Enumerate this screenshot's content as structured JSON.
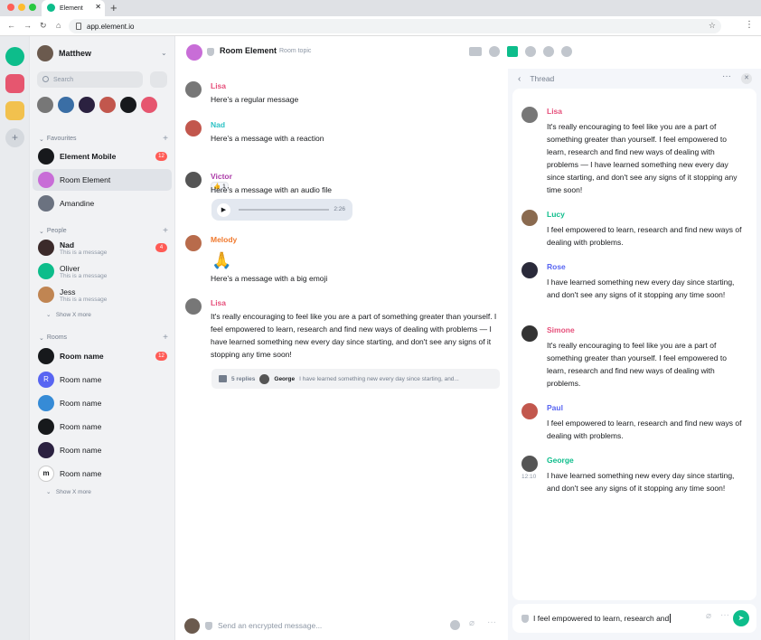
{
  "browser": {
    "tab_title": "Element",
    "url": "app.element.io",
    "dot_colors": [
      "#ff5f57",
      "#febc2e",
      "#28c840"
    ]
  },
  "user": {
    "name": "Matthew"
  },
  "search": {
    "placeholder": "Search"
  },
  "sections": {
    "favourites": "Favourites",
    "people": "People",
    "rooms": "Rooms",
    "show_more": "Show X more"
  },
  "favourites": [
    {
      "name": "Element Mobile",
      "badge": "12",
      "color": "#17191c"
    },
    {
      "name": "Room Element",
      "badge": "",
      "color": "#c86dd7"
    },
    {
      "name": "Amandine",
      "badge": "",
      "color": "#6b7280"
    }
  ],
  "people": [
    {
      "name": "Nad",
      "preview": "This is a message",
      "badge": "4",
      "color": "#3b2a2a"
    },
    {
      "name": "Oliver",
      "preview": "This is a message",
      "badge": "",
      "color": "#0dbd8b"
    },
    {
      "name": "Jess",
      "preview": "This is a message",
      "badge": "",
      "color": "#c08552"
    }
  ],
  "rooms": [
    {
      "name": "Room name",
      "badge": "12",
      "color": "#17191c",
      "bold": true
    },
    {
      "name": "Room name",
      "badge": "",
      "color": "#5865f2",
      "letter": "R"
    },
    {
      "name": "Room name",
      "badge": "",
      "color": "#368bd6"
    },
    {
      "name": "Room name",
      "badge": "",
      "color": "#17191c"
    },
    {
      "name": "Room name",
      "badge": "",
      "color": "#2b2140"
    },
    {
      "name": "Room name",
      "badge": "",
      "color": "#ffffff",
      "letter": "m"
    }
  ],
  "room": {
    "title": "Room Element",
    "topic": "Room topic"
  },
  "timeline": [
    {
      "sender": "Lisa",
      "color": "#e64f7a",
      "body": "Here’s a regular message"
    },
    {
      "sender": "Nad",
      "color": "#2dc2c5",
      "body": "Here’s a message with a reaction",
      "reaction": "👍 1"
    },
    {
      "sender": "Victor",
      "color": "#ac3ba8",
      "body": "Here’s a message with an audio file",
      "audio_time": "2:26"
    },
    {
      "sender": "Melody",
      "color": "#f07a2f",
      "body": "Here’s a message with a big emoji",
      "emoji": "🙏"
    },
    {
      "sender": "Lisa",
      "color": "#e64f7a",
      "body": "It's really encouraging to feel like you are a part of something greater than yourself. I feel empowered to learn, research and find new ways of dealing with problems — I have learned something new every day since starting, and don't see any signs of it stopping any time soon!"
    }
  ],
  "thread_summary": {
    "replies": "5 replies",
    "sender": "George",
    "preview": "I have learned something new every day since starting, and..."
  },
  "composer": {
    "placeholder": "Send an encrypted message..."
  },
  "thread": {
    "title": "Thread",
    "messages": [
      {
        "sender": "Lisa",
        "color": "#e64f7a",
        "body": "It's really encouraging to feel like you are a part of something greater than yourself. I feel empowered to learn, research and find new ways of dealing with problems — I have learned something new every day since starting, and don't see any signs of it stopping any time soon!"
      },
      {
        "sender": "Lucy",
        "color": "#0dbd8b",
        "body": "I feel empowered to learn, research and find new ways of dealing with problems."
      },
      {
        "sender": "Rose",
        "color": "#5865f2",
        "body": "I have learned something new every day since starting, and don't see any signs of it stopping any time soon!"
      },
      {
        "sender": "Simone",
        "color": "#e64f7a",
        "body": "It's really encouraging to feel like you are a part of something greater than yourself. I feel empowered to learn, research and find new ways of dealing with problems."
      },
      {
        "sender": "Paul",
        "color": "#5865f2",
        "body": "I feel empowered to learn, research and find new ways of dealing with problems."
      },
      {
        "sender": "George",
        "color": "#0dbd8b",
        "body": "I have learned something new every day since starting, and don't see any signs of it stopping any time soon!",
        "time": "12:10"
      }
    ],
    "composer_value": "I feel empowered to learn, research and"
  }
}
